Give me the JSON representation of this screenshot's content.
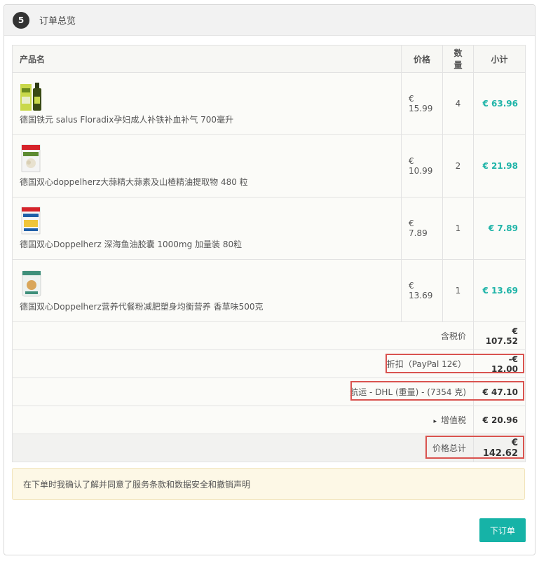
{
  "header": {
    "step_number": "5",
    "title": "订单总览"
  },
  "table": {
    "columns": {
      "product": "产品名",
      "price": "价格",
      "qty": "数量",
      "subtotal": "小计"
    },
    "rows": [
      {
        "name": "德国铁元 salus Floradix孕妇成人补铁补血补气 700毫升",
        "price": "€ 15.99",
        "qty": "4",
        "subtotal": "€ 63.96"
      },
      {
        "name": "德国双心doppelherz大蒜精大蒜素及山楂精油提取物 480 粒",
        "price": "€ 10.99",
        "qty": "2",
        "subtotal": "€ 21.98"
      },
      {
        "name": "德国双心Doppelherz 深海鱼油胶囊 1000mg 加量装 80粒",
        "price": "€ 7.89",
        "qty": "1",
        "subtotal": "€ 7.89"
      },
      {
        "name": "德国双心Doppelherz营养代餐粉减肥塑身均衡营养 香草味500克",
        "price": "€ 13.69",
        "qty": "1",
        "subtotal": "€ 13.69"
      }
    ]
  },
  "summary": {
    "tax_incl_label": "含税价",
    "tax_incl_value": "€ 107.52",
    "discount_label": "折扣（PayPal 12€）",
    "discount_value": "-€ 12.00",
    "shipping_label": "航运 - DHL (重量) - (7354 克)",
    "shipping_value": "€ 47.10",
    "vat_label": "增值税",
    "vat_value": "€ 20.96",
    "total_label": "价格总计",
    "total_value": "€ 142.62"
  },
  "notice": {
    "text": "在下单时我确认了解并同意了服务条款和数据安全和撤销声明"
  },
  "actions": {
    "submit_label": "下订单"
  },
  "colors": {
    "accent": "#16b3a7",
    "subtotal": "#1fb4a8",
    "highlight": "#d9534f",
    "notice_bg": "#fdf8e6"
  }
}
